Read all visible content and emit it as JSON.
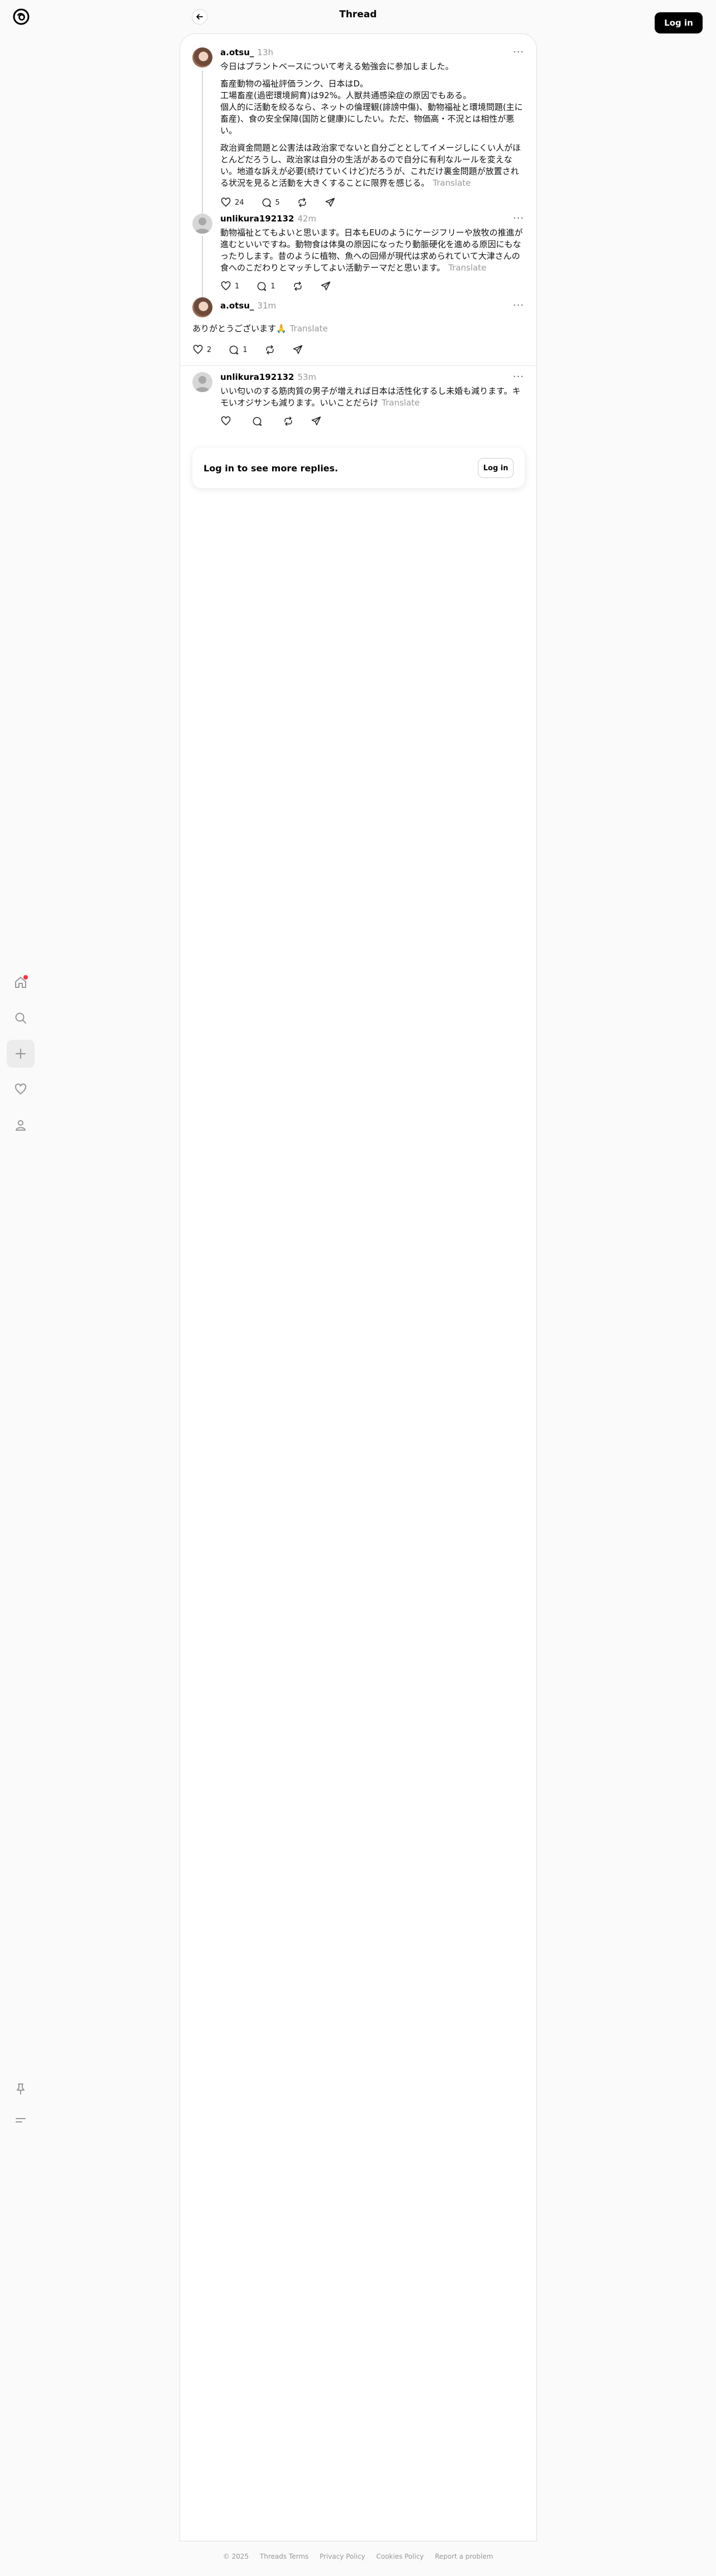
{
  "header": {
    "title": "Thread",
    "login_label": "Log in"
  },
  "nav": {
    "items": [
      "home-icon",
      "search-icon",
      "create-icon",
      "heart-icon",
      "profile-icon"
    ],
    "bottom": [
      "pin-icon",
      "menu-icon"
    ]
  },
  "posts": [
    {
      "username": "a.otsu_",
      "time": "13h",
      "paragraphs": [
        "今日はプラントベースについて考える勉強会に参加しました。",
        "畜産動物の福祉評価ランク、日本はD。\n工場畜産(過密環境飼育)は92%。人獣共通感染症の原因でもある。\n個人的に活動を絞るなら、ネットの倫理観(誹謗中傷)、動物福祉と環境問題(主に畜産)、食の安全保障(国防と健康)にしたい。ただ、物価高・不況とは相性が悪い。",
        "政治資金問題と公害法は政治家でないと自分ごととしてイメージしにくい人がほとんどだろうし、政治家は自分の生活があるので自分に有利なルールを変えない。地道な訴えが必要(続けていくけど)だろうが、これだけ裏金問題が放置される状況を見ると活動を大きくすることに限界を感じる。"
      ],
      "translate": "Translate",
      "likes": "24",
      "comments": "5"
    },
    {
      "username": "unlikura192132",
      "time": "42m",
      "paragraphs": [
        "動物福祉とてもよいと思います。日本もEUのようにケージフリーや放牧の推進が進むといいですね。動物食は体臭の原因になったり動脈硬化を進める原因にもなったりします。昔のように植物、魚への回帰が現代は求められていて大津さんの食へのこだわりとマッチしてよい活動テーマだと思います。"
      ],
      "translate": "Translate",
      "likes": "1",
      "comments": "1"
    },
    {
      "username": "a.otsu_",
      "time": "31m",
      "paragraphs": [
        "ありがとうございます🙏"
      ],
      "translate": "Translate",
      "likes": "2",
      "comments": "1"
    },
    {
      "username": "unlikura192132",
      "time": "53m",
      "paragraphs": [
        "いい匂いのする筋肉質の男子が増えれば日本は活性化するし未婚も減ります。キモいオジサンも減ります。いいことだらけ"
      ],
      "translate": "Translate",
      "likes": "",
      "comments": ""
    }
  ],
  "login_card": {
    "text": "Log in to see more replies.",
    "button": "Log in"
  },
  "footer": {
    "links": [
      "© 2025",
      "Threads Terms",
      "Privacy Policy",
      "Cookies Policy",
      "Report a problem"
    ]
  }
}
